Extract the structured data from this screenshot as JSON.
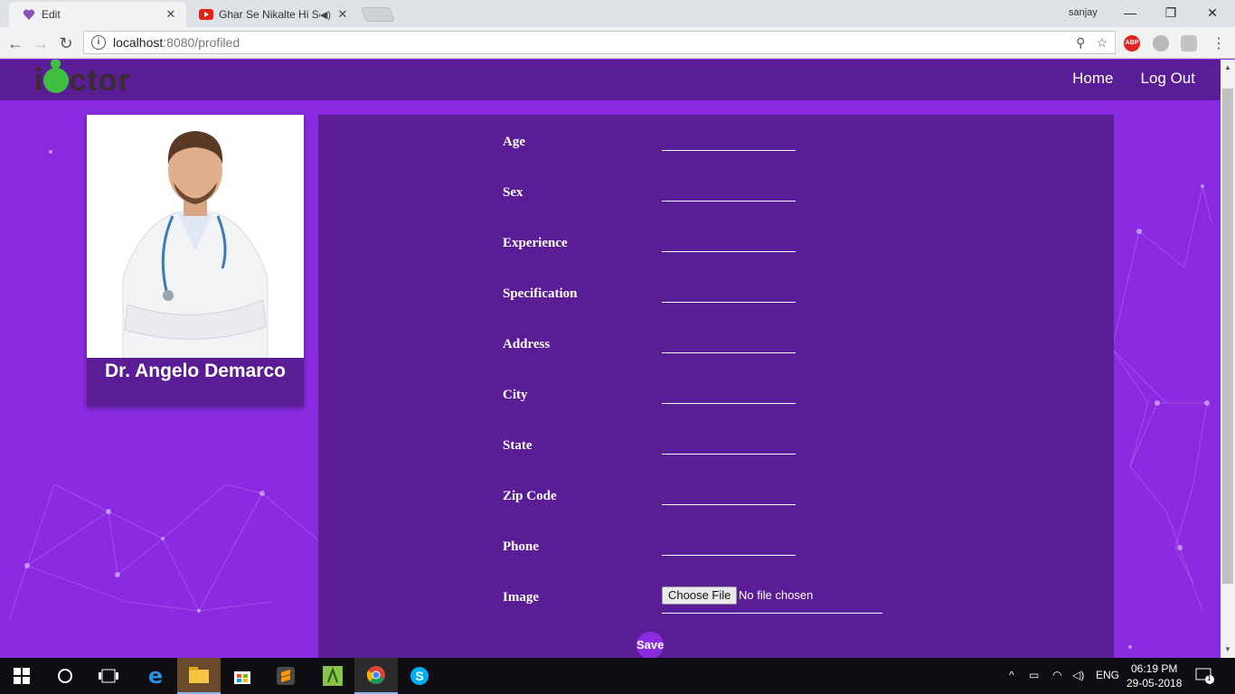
{
  "browser": {
    "tabs": [
      {
        "title": "Edit",
        "active": true
      },
      {
        "title": "Ghar Se Nikalte Hi So",
        "active": false
      }
    ],
    "profile": "sanjay",
    "url_host": "localhost",
    "url_path": ":8080/profiled"
  },
  "site": {
    "logo": "iDoctor",
    "nav": {
      "home": "Home",
      "logout": "Log Out"
    }
  },
  "profile_card": {
    "name": "Dr. Angelo Demarco"
  },
  "form": {
    "fields": [
      {
        "label": "Age"
      },
      {
        "label": "Sex"
      },
      {
        "label": "Experience"
      },
      {
        "label": "Specification"
      },
      {
        "label": "Address"
      },
      {
        "label": "City"
      },
      {
        "label": "State"
      },
      {
        "label": "Zip Code"
      },
      {
        "label": "Phone"
      }
    ],
    "image_label": "Image",
    "file_button": "Choose File",
    "file_status": "No file chosen",
    "save": "Save"
  },
  "taskbar": {
    "lang": "ENG",
    "time": "06:19 PM",
    "date": "29-05-2018",
    "notifications": "1"
  },
  "colors": {
    "page_bg": "#8a2be2",
    "panel_bg": "#5b1d96",
    "logo_green": "#3fbf3f"
  }
}
